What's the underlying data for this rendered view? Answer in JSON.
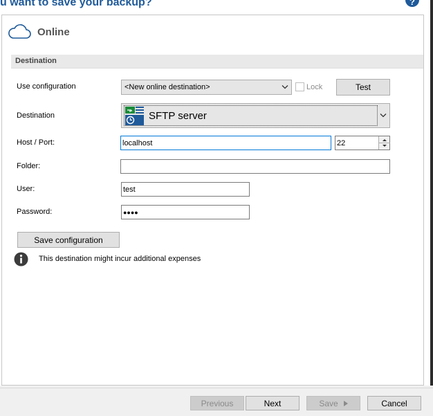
{
  "header": {
    "title": "u want to save your backup?",
    "help_icon": "help-icon"
  },
  "panel": {
    "title": "Online",
    "icon": "cloud-icon"
  },
  "section": {
    "title": "Destination"
  },
  "form": {
    "use_configuration_label": "Use configuration",
    "use_configuration_value": "<New online destination>",
    "lock_label": "Lock",
    "lock_checked": false,
    "test_button": "Test",
    "destination_label": "Destination",
    "destination_value": "SFTP server",
    "destination_icon": "sftp-server-icon",
    "host_port_label": "Host / Port:",
    "host_value": "localhost",
    "port_value": "22",
    "folder_label": "Folder:",
    "folder_value": "",
    "user_label": "User:",
    "user_value": "test",
    "password_label": "Password:",
    "password_value": "●●●●",
    "save_configuration_button": "Save configuration",
    "info_icon": "info-icon",
    "info_text": "This destination might incur additional expenses"
  },
  "footer": {
    "previous_button": "Previous",
    "next_button": "Next",
    "save_button": "Save",
    "cancel_button": "Cancel"
  },
  "colors": {
    "accent": "#1f5a9a",
    "focus_border": "#0078d7",
    "section_bar": "#e9e9e9"
  }
}
